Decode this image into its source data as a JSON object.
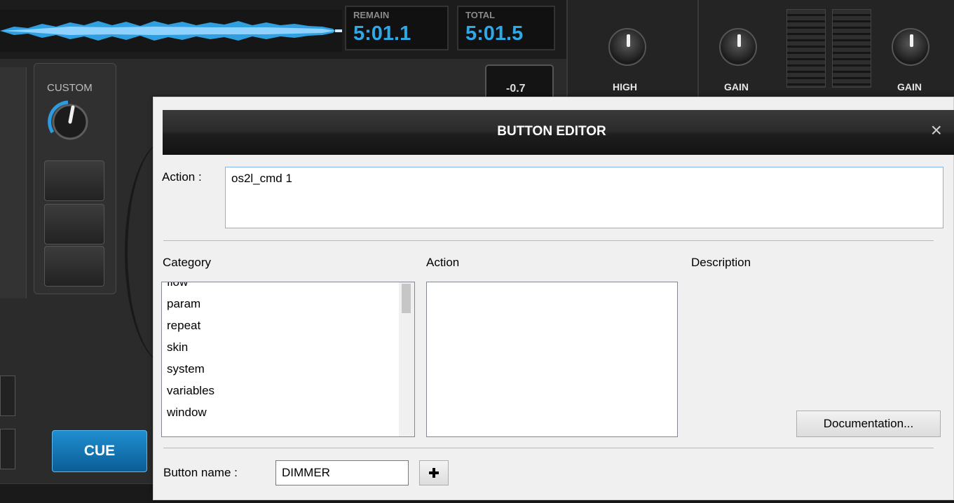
{
  "deck": {
    "remain_label": "REMAIN",
    "remain_value": "5:01.1",
    "total_label": "TOTAL",
    "total_value": "5:01.5",
    "custom_label": "CUSTOM",
    "pitch_value": "-0.7",
    "cue_label": "CUE"
  },
  "mixer": {
    "high_label": "HIGH",
    "gain_left_label": "GAIN",
    "gain_right_label": "GAIN"
  },
  "dialog": {
    "title": "BUTTON EDITOR",
    "close_glyph": "×",
    "action_label": "Action :",
    "action_value": "os2l_cmd 1",
    "category_header": "Category",
    "action_header": "Action",
    "description_header": "Description",
    "categories": [
      "flow",
      "param",
      "repeat",
      "skin",
      "system",
      "variables",
      "window"
    ],
    "documentation_button": "Documentation...",
    "button_name_label": "Button name :",
    "button_name_value": "DIMMER"
  },
  "colors": {
    "accent_blue": "#2fa8e8",
    "cue_blue": "#1478b8",
    "dialog_bg": "#f0f0f0",
    "input_focus_border": "#7eb4ea"
  }
}
